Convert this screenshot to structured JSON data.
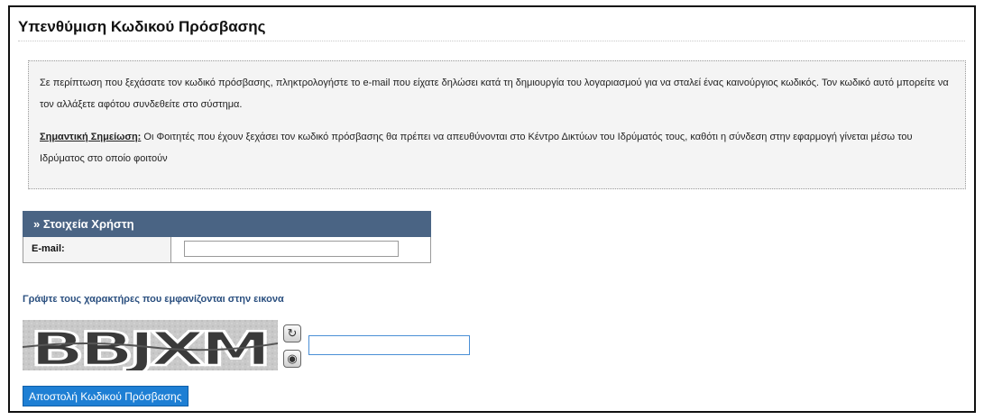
{
  "page": {
    "title": "Υπενθύμιση Κωδικού Πρόσβασης"
  },
  "info": {
    "paragraph1": "Σε περίπτωση που ξεχάσατε τον κωδικό πρόσβασης, πληκτρολογήστε το e-mail που είχατε δηλώσει κατά τη δημιουργία του λογαριασμού για να σταλεί ένας καινούργιος κωδικός. Τον κωδικό αυτό μπορείτε να τον αλλάξετε αφότου συνδεθείτε στο σύστημα.",
    "note_label": "Σημαντική Σημείωση:",
    "note_text": " Οι Φοιτητές που έχουν ξεχάσει τον κωδικό πρόσβασης θα πρέπει να απευθύνονται στο Κέντρο Δικτύων του Ιδρύματός τους, καθότι η σύνδεση στην εφαρμογή γίνεται μέσω του Ιδρύματος στο οποίο φοιτούν"
  },
  "user_details": {
    "header": "» Στοιχεία Χρήστη",
    "email_label": "E-mail:",
    "email_value": ""
  },
  "captcha": {
    "heading": "Γράψτε τους χαρακτήρες που εμφανίζονται στην εικονα",
    "image_text": "BBJXM",
    "refresh_icon": "refresh-icon",
    "audio_icon": "audio-icon",
    "input_value": ""
  },
  "actions": {
    "submit_label": "Αποστολή Κωδικού Πρόσβασης"
  },
  "colors": {
    "header_bg": "#4a6484",
    "heading_blue": "#2a4f7f",
    "button_bg": "#1e7fd4"
  }
}
